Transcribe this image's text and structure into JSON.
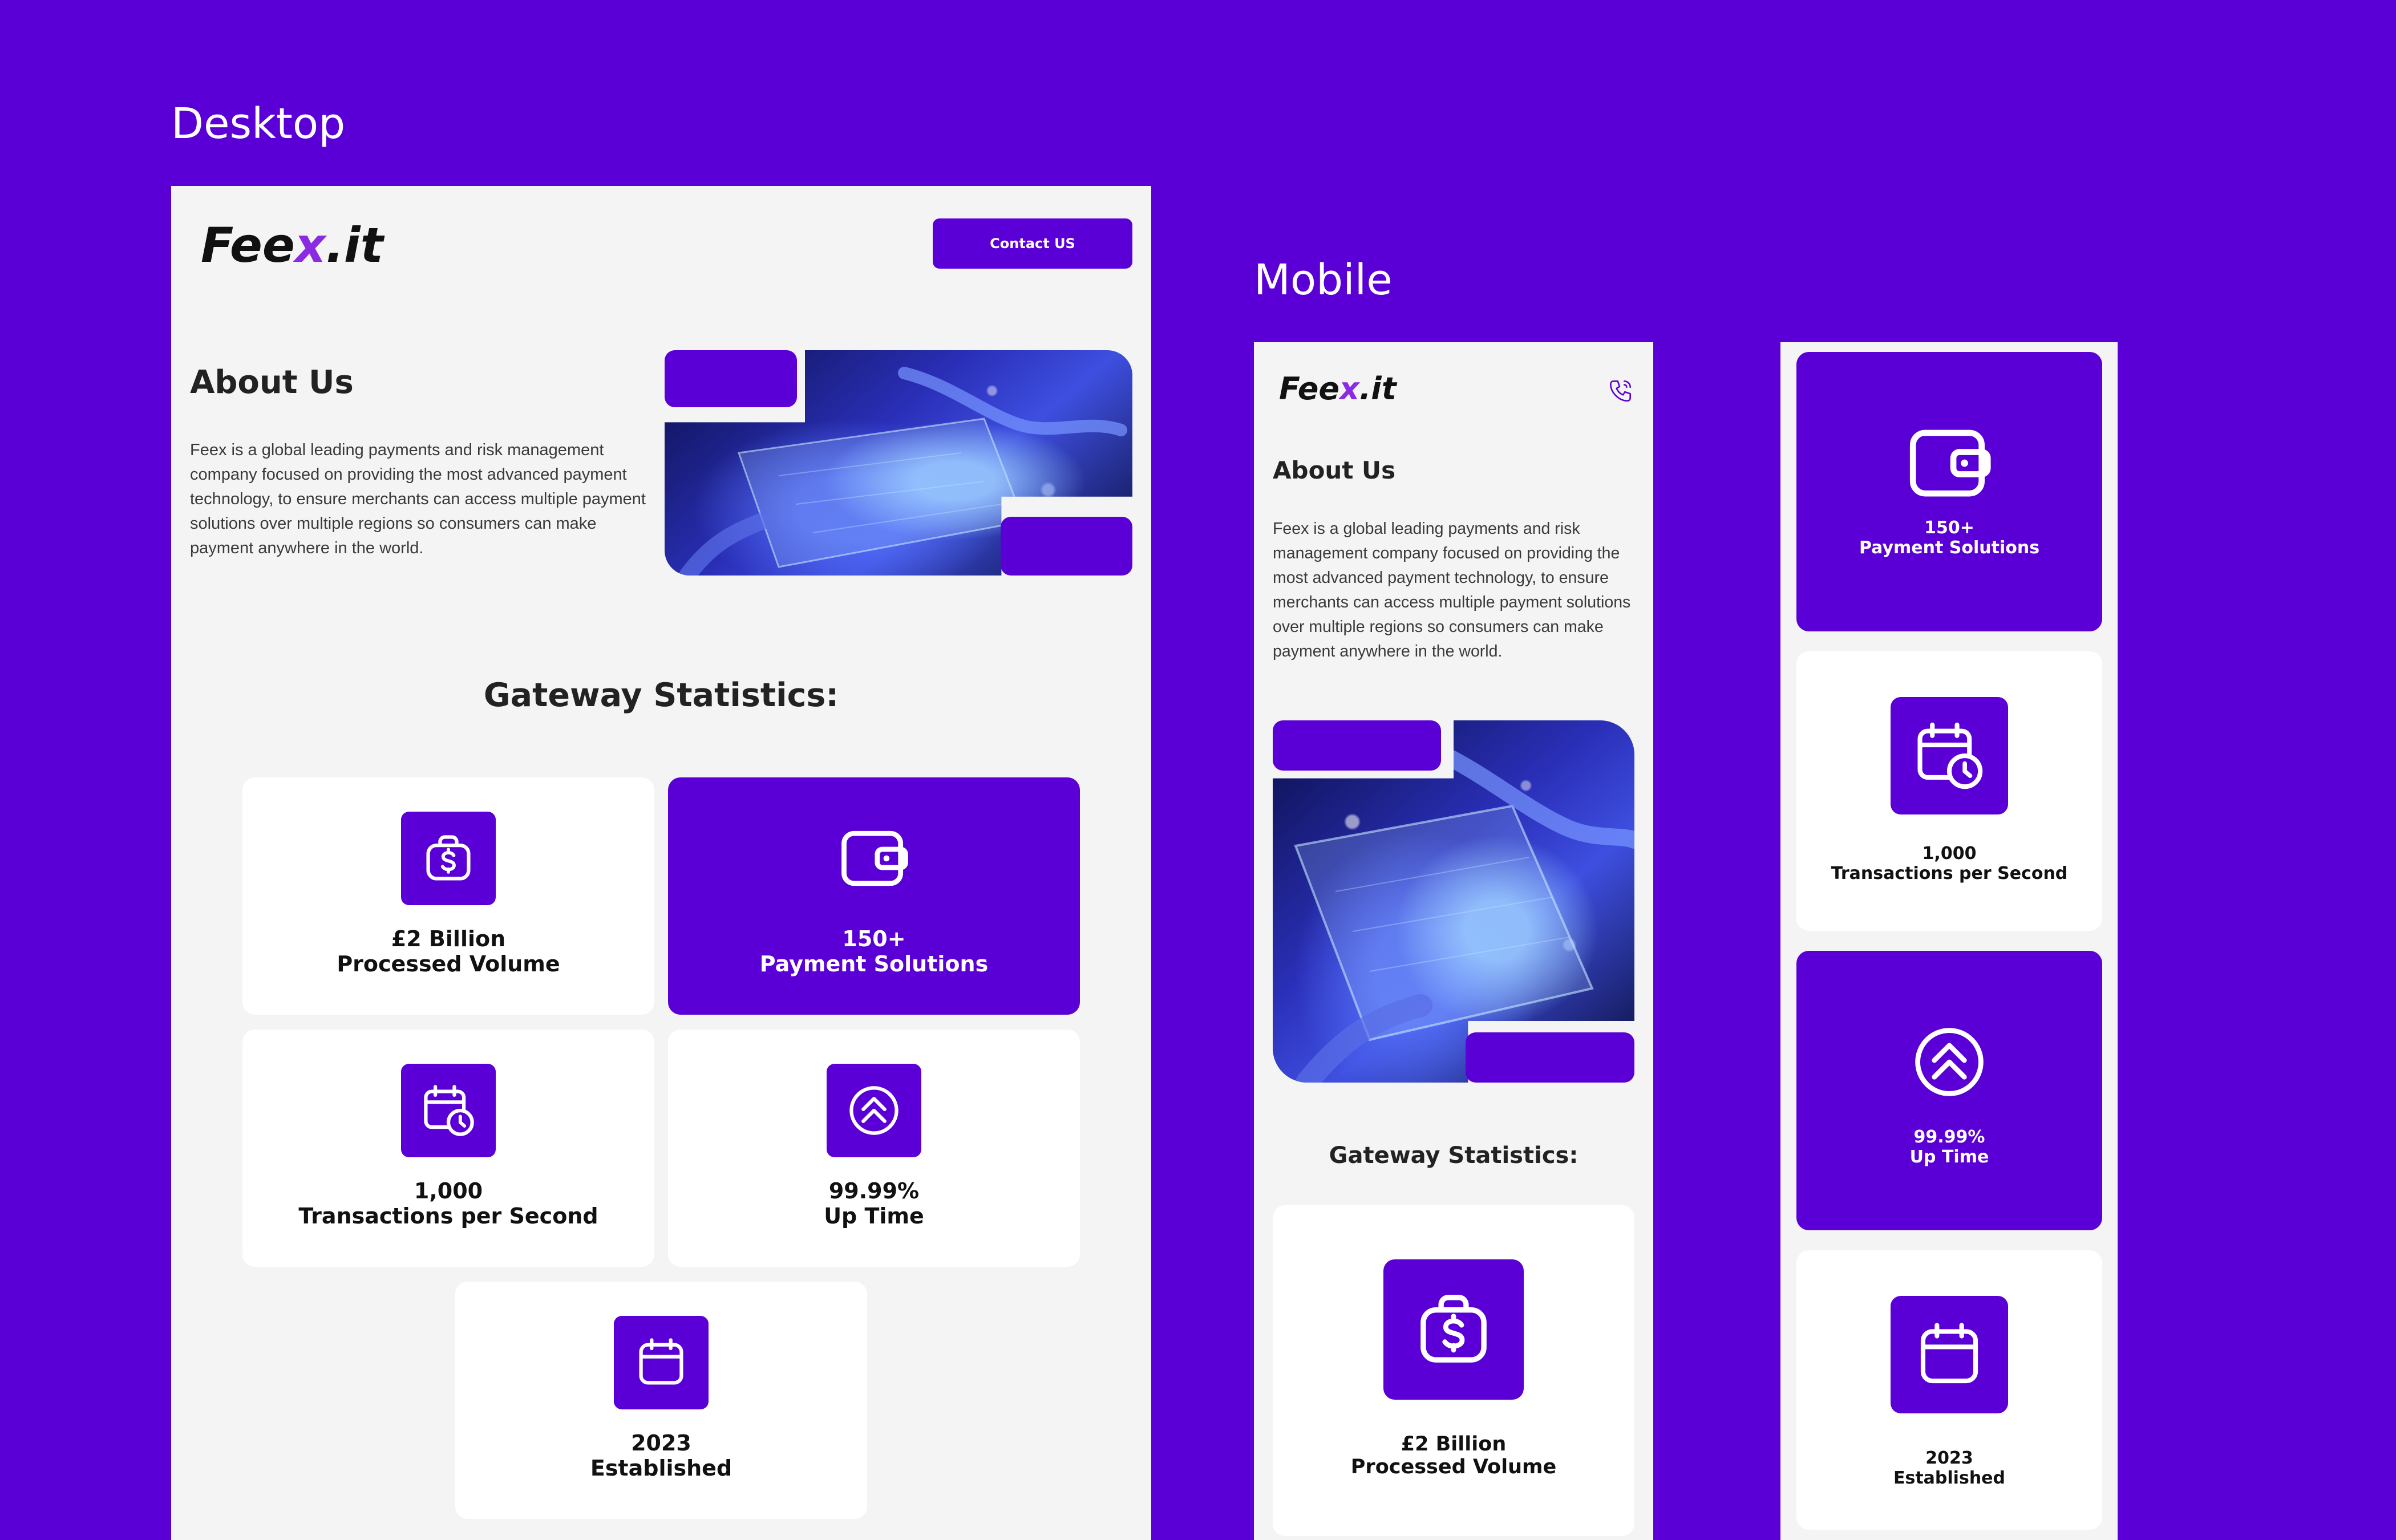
{
  "labels": {
    "desktop": "Desktop",
    "mobile": "Mobile"
  },
  "brand": {
    "logo_left": "Fee",
    "logo_x": "x",
    "logo_right": ".it"
  },
  "header": {
    "contact_label": "Contact US"
  },
  "about": {
    "title": "About Us",
    "body": "Feex is a global leading payments and risk management company focused on providing the most advanced payment technology, to ensure merchants can access multiple payment solutions over multiple regions so consumers can make payment anywhere in the world."
  },
  "stats": {
    "title": "Gateway Statistics:",
    "items": [
      {
        "value": "£2 Billion",
        "label": "Processed Volume",
        "icon": "money-bag-icon"
      },
      {
        "value": "150+",
        "label": "Payment Solutions",
        "icon": "wallet-icon"
      },
      {
        "value": "1,000",
        "label": "Transactions per Second",
        "icon": "calendar-clock-icon"
      },
      {
        "value": "99.99%",
        "label": "Up Time",
        "icon": "chevrons-up-circle-icon"
      },
      {
        "value": "2023",
        "label": "Established",
        "icon": "calendar-icon"
      }
    ]
  },
  "colors": {
    "brand": "#5a00d6",
    "canvas": "#f4f4f4",
    "card": "#ffffff",
    "text": "#111111"
  }
}
